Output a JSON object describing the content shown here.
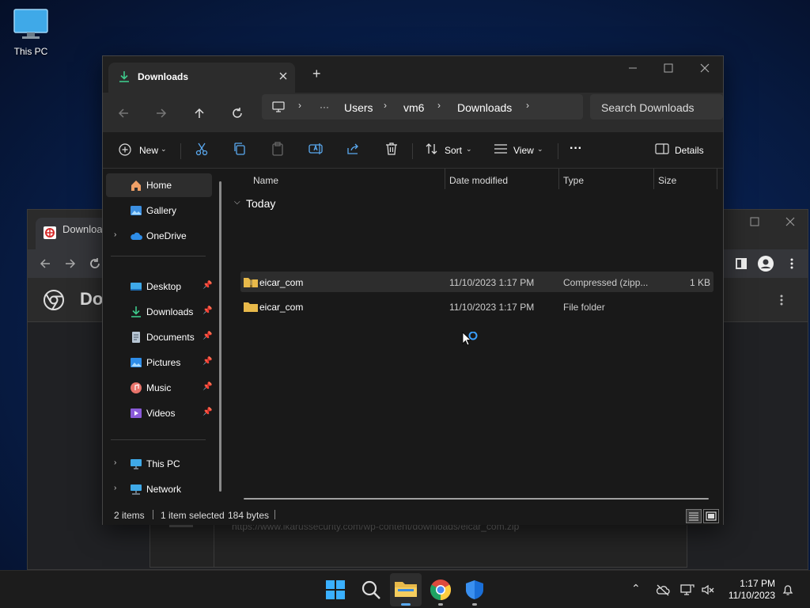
{
  "desktop": {
    "this_pc_label": "This PC"
  },
  "chrome": {
    "tab_title": "Downloa",
    "header_title": "Do",
    "download_url": "https://www.ikarussecurity.com/wp-content/downloads/eicar_com.zip"
  },
  "explorer": {
    "tab_title": "Downloads",
    "new_tab": "+",
    "breadcrumb": {
      "overflow": "···",
      "items": [
        "Users",
        "vm6",
        "Downloads"
      ]
    },
    "search_placeholder": "Search Downloads",
    "commands": {
      "new": "New",
      "sort": "Sort",
      "view": "View",
      "more": "···",
      "details": "Details"
    },
    "nav": {
      "home": "Home",
      "gallery": "Gallery",
      "onedrive": "OneDrive",
      "desktop": "Desktop",
      "downloads": "Downloads",
      "documents": "Documents",
      "pictures": "Pictures",
      "music": "Music",
      "videos": "Videos",
      "this_pc": "This PC",
      "network": "Network"
    },
    "columns": {
      "name": "Name",
      "date": "Date modified",
      "type": "Type",
      "size": "Size"
    },
    "group": "Today",
    "files": [
      {
        "name": "eicar_com",
        "date": "11/10/2023 1:17 PM",
        "type": "Compressed (zipp...",
        "size": "1 KB"
      },
      {
        "name": "eicar_com",
        "date": "11/10/2023 1:17 PM",
        "type": "File folder",
        "size": ""
      }
    ],
    "status": {
      "count": "2 items",
      "selected": "1 item selected",
      "bytes": "184 bytes"
    }
  },
  "taskbar": {
    "time": "1:17 PM",
    "date": "11/10/2023"
  },
  "colors": {
    "accent": "#0078d4",
    "folder": "#e8b94a"
  }
}
